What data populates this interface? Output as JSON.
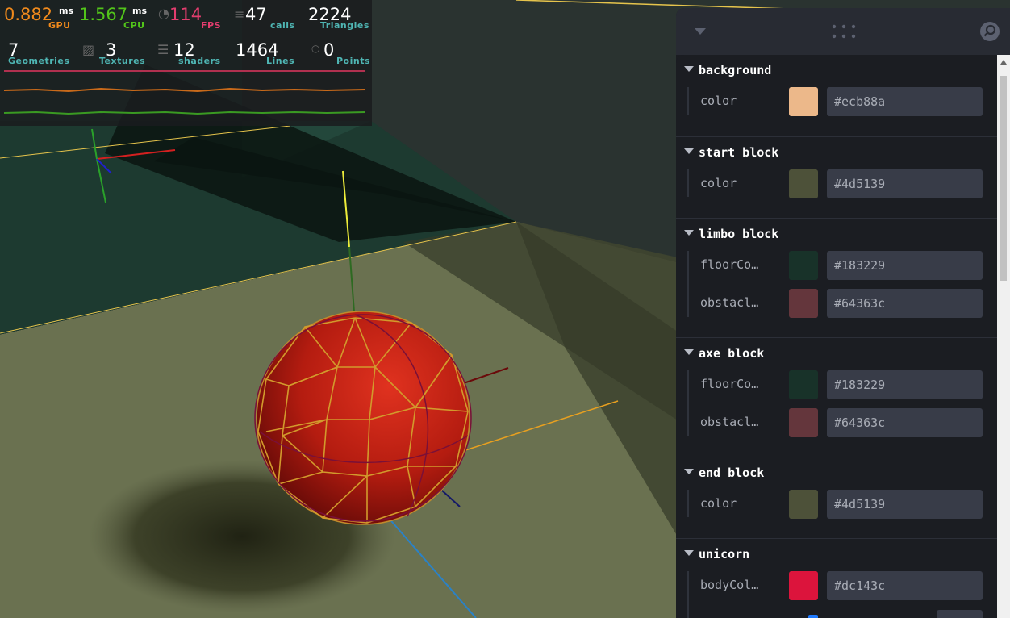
{
  "stats": {
    "gpu": {
      "value": "0.882",
      "unit": "ms",
      "label": "GPU"
    },
    "cpu": {
      "value": "1.567",
      "unit": "ms",
      "label": "CPU"
    },
    "fps": {
      "value": "114",
      "label": "FPS"
    },
    "calls": {
      "value": "47",
      "label": "calls"
    },
    "triangles": {
      "value": "2224",
      "label": "Triangles"
    },
    "geometries": {
      "value": "7",
      "label": "Geometries"
    },
    "textures": {
      "value": "3",
      "label": "Textures"
    },
    "shaders": {
      "value": "12",
      "label": "shaders"
    },
    "lines": {
      "value": "1464",
      "label": "Lines"
    },
    "points": {
      "value": "0",
      "label": "Points"
    }
  },
  "gui": {
    "folders": [
      {
        "title": "background",
        "rows": [
          {
            "name": "color",
            "color": "#ecb88a",
            "hex": "#ecb88a"
          }
        ]
      },
      {
        "title": "start block",
        "rows": [
          {
            "name": "color",
            "color": "#4d5139",
            "hex": "#4d5139"
          }
        ]
      },
      {
        "title": "limbo block",
        "rows": [
          {
            "name": "floorCo…",
            "color": "#183229",
            "hex": "#183229"
          },
          {
            "name": "obstacl…",
            "color": "#64363c",
            "hex": "#64363c"
          }
        ]
      },
      {
        "title": "axe block",
        "rows": [
          {
            "name": "floorCo…",
            "color": "#183229",
            "hex": "#183229"
          },
          {
            "name": "obstacl…",
            "color": "#64363c",
            "hex": "#64363c"
          }
        ]
      },
      {
        "title": "end block",
        "rows": [
          {
            "name": "color",
            "color": "#4d5139",
            "hex": "#4d5139"
          }
        ]
      },
      {
        "title": "unicorn",
        "rows": [
          {
            "name": "bodyCol…",
            "color": "#dc143c",
            "hex": "#dc143c"
          }
        ]
      }
    ]
  },
  "icons": {
    "collapse": "chevron-down-icon",
    "drag": "drag-handle-icon",
    "search": "search-icon"
  },
  "scene_colors": {
    "background": "#ecb88a",
    "floor": "#183229",
    "block": "#4d5139",
    "sphere": "#c0271a"
  }
}
